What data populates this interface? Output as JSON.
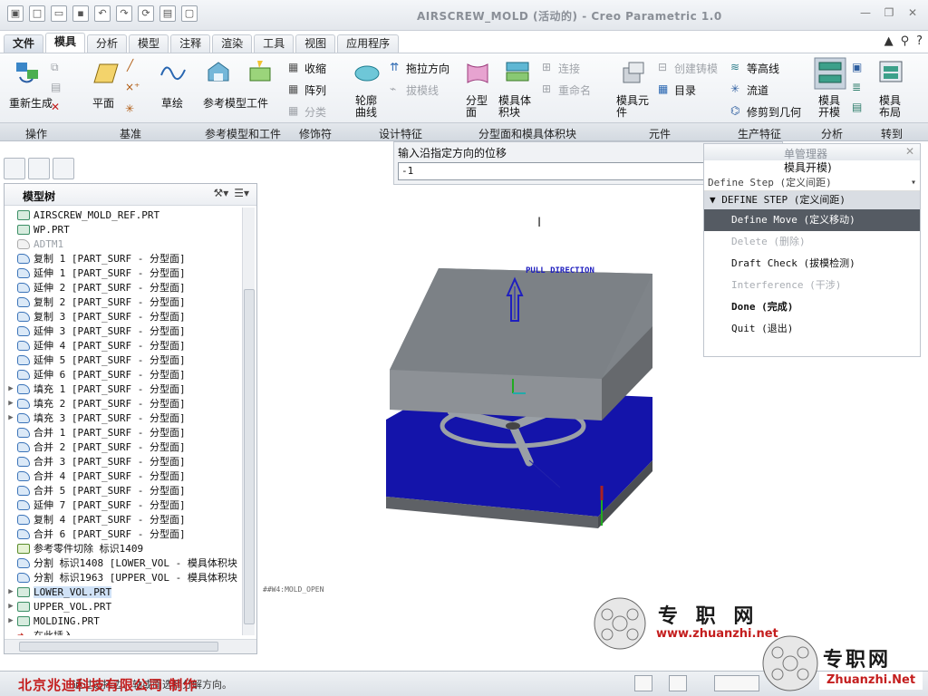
{
  "window": {
    "title": "AIRSCREW_MOLD (活动的) - Creo Parametric 1.0"
  },
  "tabs": [
    "文件",
    "模具",
    "分析",
    "模型",
    "注释",
    "渲染",
    "工具",
    "视图",
    "应用程序"
  ],
  "ribbon": {
    "regenerate": "重新生成",
    "plane": "平面",
    "sketch": "草绘",
    "ref_model": "参考模型",
    "workpiece": "工件",
    "shrink": "收缩",
    "pattern": "阵列",
    "classify": "分类",
    "profile_curve": "轮廓曲线",
    "drag_direction": "拖拉方向",
    "draft_line": "拔模线",
    "parting_surface": "分型面",
    "mold_volume": "模具体积块",
    "connect": "连接",
    "rename": "重命名",
    "mold_component": "模具元件",
    "create_casting": "创建铸模",
    "catalog": "目录",
    "contour": "等高线",
    "flow": "流道",
    "trim_geometry": "修剪到几何",
    "mold_open": "模具开模",
    "mold_layout": "模具布局"
  },
  "groups": [
    "操作",
    "基准",
    "参考模型和工件",
    "修饰符",
    "设计特征",
    "分型面和模具体积块",
    "元件",
    "生产特征",
    "分析",
    "转到"
  ],
  "input_panel": {
    "label": "输入沿指定方向的位移",
    "value": "-1"
  },
  "menu_manager": {
    "title": "单管理器",
    "subtitle": "模具开模)",
    "step_row": "Define Step (定义间距)",
    "section": "DEFINE STEP (定义间距)",
    "items": [
      {
        "label": "Define Move (定义移动)",
        "state": "selected"
      },
      {
        "label": "Delete (删除)",
        "state": "disabled"
      },
      {
        "label": "Draft Check (拔模检测)",
        "state": "normal"
      },
      {
        "label": "Interference (干涉)",
        "state": "disabled"
      },
      {
        "label": "Done (完成)",
        "state": "bold"
      },
      {
        "label": "Quit (退出)",
        "state": "normal"
      }
    ]
  },
  "model_tree": {
    "title": "模型树",
    "rows": [
      {
        "text": "AIRSCREW_MOLD_REF.PRT",
        "icon": "part",
        "exp": ""
      },
      {
        "text": "WP.PRT",
        "icon": "part",
        "exp": ""
      },
      {
        "text": "ADTM1",
        "icon": "datum",
        "exp": "",
        "dim": true
      },
      {
        "text": "复制 1 [PART_SURF - 分型面]",
        "icon": "surf",
        "exp": ""
      },
      {
        "text": "延伸 1 [PART_SURF - 分型面]",
        "icon": "surf",
        "exp": ""
      },
      {
        "text": "延伸 2 [PART_SURF - 分型面]",
        "icon": "surf",
        "exp": ""
      },
      {
        "text": "复制 2 [PART_SURF - 分型面]",
        "icon": "surf",
        "exp": ""
      },
      {
        "text": "复制 3 [PART_SURF - 分型面]",
        "icon": "surf",
        "exp": ""
      },
      {
        "text": "延伸 3 [PART_SURF - 分型面]",
        "icon": "surf",
        "exp": ""
      },
      {
        "text": "延伸 4 [PART_SURF - 分型面]",
        "icon": "surf",
        "exp": ""
      },
      {
        "text": "延伸 5 [PART_SURF - 分型面]",
        "icon": "surf",
        "exp": ""
      },
      {
        "text": "延伸 6 [PART_SURF - 分型面]",
        "icon": "surf",
        "exp": ""
      },
      {
        "text": "填充 1 [PART_SURF - 分型面]",
        "icon": "surf",
        "exp": "▶"
      },
      {
        "text": "填充 2 [PART_SURF - 分型面]",
        "icon": "surf",
        "exp": "▶"
      },
      {
        "text": "填充 3 [PART_SURF - 分型面]",
        "icon": "surf",
        "exp": "▶"
      },
      {
        "text": "合并 1 [PART_SURF - 分型面]",
        "icon": "surf",
        "exp": ""
      },
      {
        "text": "合并 2 [PART_SURF - 分型面]",
        "icon": "surf",
        "exp": ""
      },
      {
        "text": "合并 3 [PART_SURF - 分型面]",
        "icon": "surf",
        "exp": ""
      },
      {
        "text": "合并 4 [PART_SURF - 分型面]",
        "icon": "surf",
        "exp": ""
      },
      {
        "text": "合并 5 [PART_SURF - 分型面]",
        "icon": "surf",
        "exp": ""
      },
      {
        "text": "延伸 7 [PART_SURF - 分型面]",
        "icon": "surf",
        "exp": ""
      },
      {
        "text": "复制 4 [PART_SURF - 分型面]",
        "icon": "surf",
        "exp": ""
      },
      {
        "text": "合并 6 [PART_SURF - 分型面]",
        "icon": "surf",
        "exp": ""
      },
      {
        "text": "参考零件切除 标识1409",
        "icon": "cut",
        "exp": ""
      },
      {
        "text": "分割 标识1408 [LOWER_VOL - 模具体积块",
        "icon": "surf",
        "exp": ""
      },
      {
        "text": "分割 标识1963 [UPPER_VOL - 模具体积块",
        "icon": "surf",
        "exp": ""
      },
      {
        "text": "LOWER_VOL.PRT",
        "icon": "part",
        "exp": "▶",
        "sel": true
      },
      {
        "text": "UPPER_VOL.PRT",
        "icon": "part",
        "exp": "▶"
      },
      {
        "text": "MOLDING.PRT",
        "icon": "part",
        "exp": "▶"
      },
      {
        "text": "在此插入",
        "icon": "insert",
        "exp": ""
      }
    ]
  },
  "viewport": {
    "pull_direction": "PULL DIRECTION",
    "mold_open_label": "##W4:MOLD_OPEN",
    "colors": {
      "top_block": "#7f8489",
      "bottom_block": "#1414aa",
      "arrow": "#1f1fbf"
    }
  },
  "status": {
    "message": "通过选择边、轴或面选择分解方向。"
  },
  "overlay": {
    "company": "北京兆迪科技有限公司  制作",
    "watermark_cn": "专 职 网",
    "watermark_url": "www.zhuanzhi.net",
    "watermark_cn2": "专职网",
    "watermark_url2": "Zhuanzhi.Net"
  }
}
